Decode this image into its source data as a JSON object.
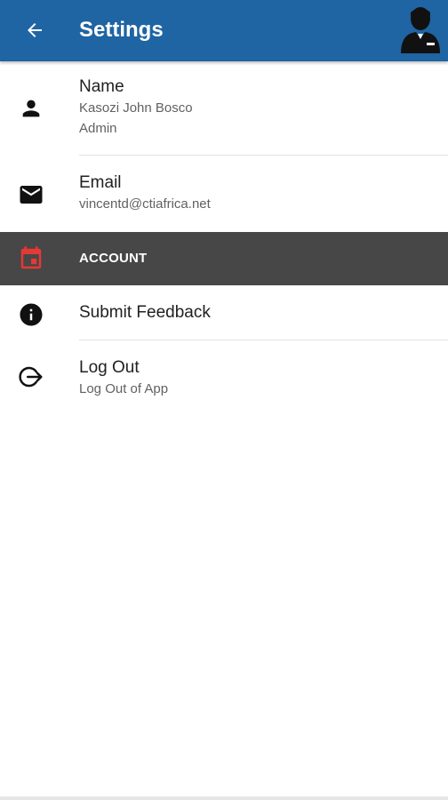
{
  "appbar": {
    "title": "Settings",
    "back_icon": "arrow-back-icon",
    "avatar_icon": "user-avatar-icon",
    "background_color": "#1f64a3"
  },
  "profile": {
    "name_label": "Name",
    "name_value": "Kasozi John Bosco",
    "role_value": "Admin",
    "name_icon": "person-icon"
  },
  "email": {
    "label": "Email",
    "value": "vincentd@ctiafrica.net",
    "icon": "mail-icon"
  },
  "account_section": {
    "title": "ACCOUNT",
    "icon": "calendar-icon",
    "icon_color": "#e53935",
    "background_color": "#474747"
  },
  "feedback": {
    "label": "Submit Feedback",
    "icon": "info-icon"
  },
  "logout": {
    "label": "Log Out",
    "subtitle": "Log Out of App",
    "icon": "logout-icon"
  }
}
